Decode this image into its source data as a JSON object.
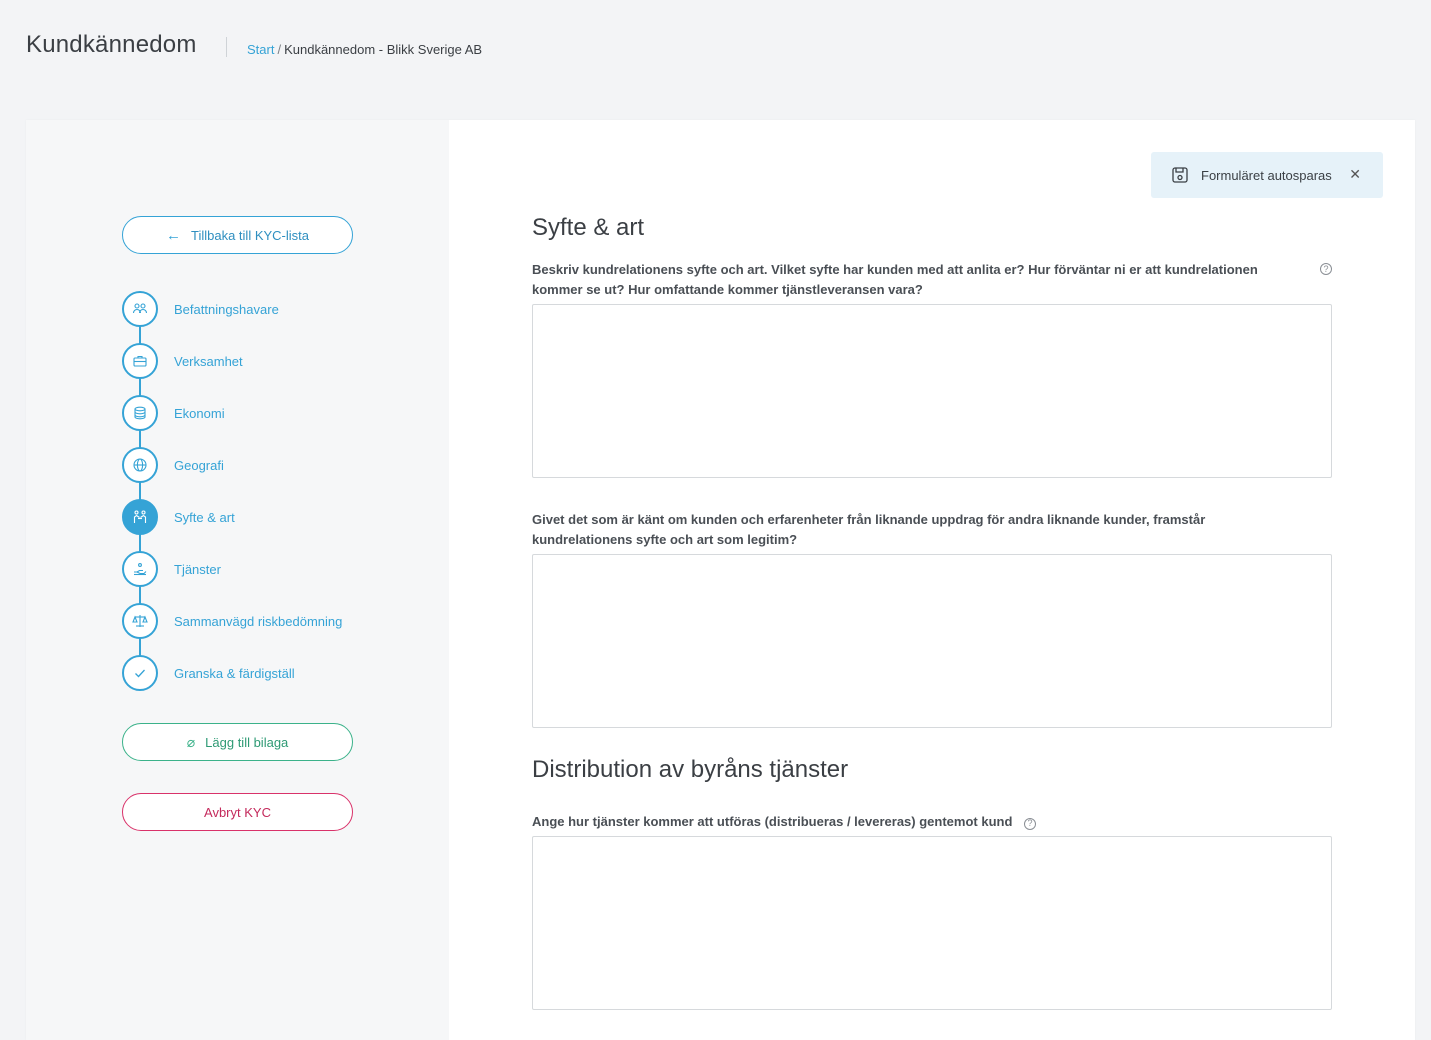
{
  "header": {
    "title": "Kundkännedom",
    "breadcrumb": {
      "root": "Start",
      "separator": "/",
      "current": "Kundkännedom - Blikk Sverige AB"
    }
  },
  "sidebar": {
    "back_label": "Tillbaka till KYC-lista",
    "steps": [
      {
        "label": "Befattningshavare",
        "icon": "people-icon"
      },
      {
        "label": "Verksamhet",
        "icon": "briefcase-icon"
      },
      {
        "label": "Ekonomi",
        "icon": "coins-icon"
      },
      {
        "label": "Geografi",
        "icon": "globe-icon"
      },
      {
        "label": "Syfte & art",
        "icon": "handshake-icon",
        "active": true
      },
      {
        "label": "Tjänster",
        "icon": "hand-service-icon"
      },
      {
        "label": "Sammanvägd riskbedömning",
        "icon": "scales-icon"
      },
      {
        "label": "Granska & färdigställ",
        "icon": "check-icon"
      }
    ],
    "attach_label": "Lägg till bilaga",
    "cancel_label": "Avbryt KYC"
  },
  "autosave": {
    "label": "Formuläret autosparas"
  },
  "sections": [
    {
      "title": "Syfte & art",
      "questions": [
        {
          "label": "Beskriv kundrelationens syfte och art. Vilket syfte har kunden med att anlita er? Hur förväntar ni er att kundrelationen kommer se ut? Hur omfattande kommer tjänstleveransen vara?",
          "value": "",
          "has_help": true
        },
        {
          "label": "Givet det som är känt om kunden och erfarenheter från liknande uppdrag för andra liknande kunder, framstår kundrelationens syfte och art som legitim?",
          "value": "",
          "has_help": false
        }
      ]
    },
    {
      "title": "Distribution av byråns tjänster",
      "questions": [
        {
          "label": "Ange hur tjänster kommer att utföras (distribueras / levereras) gentemot kund",
          "value": "",
          "has_help": true
        }
      ]
    }
  ],
  "colors": {
    "accent": "#35a3d6",
    "attach": "#3bb28a",
    "cancel": "#d9326a",
    "autosave_bg": "#e6f2f9"
  }
}
